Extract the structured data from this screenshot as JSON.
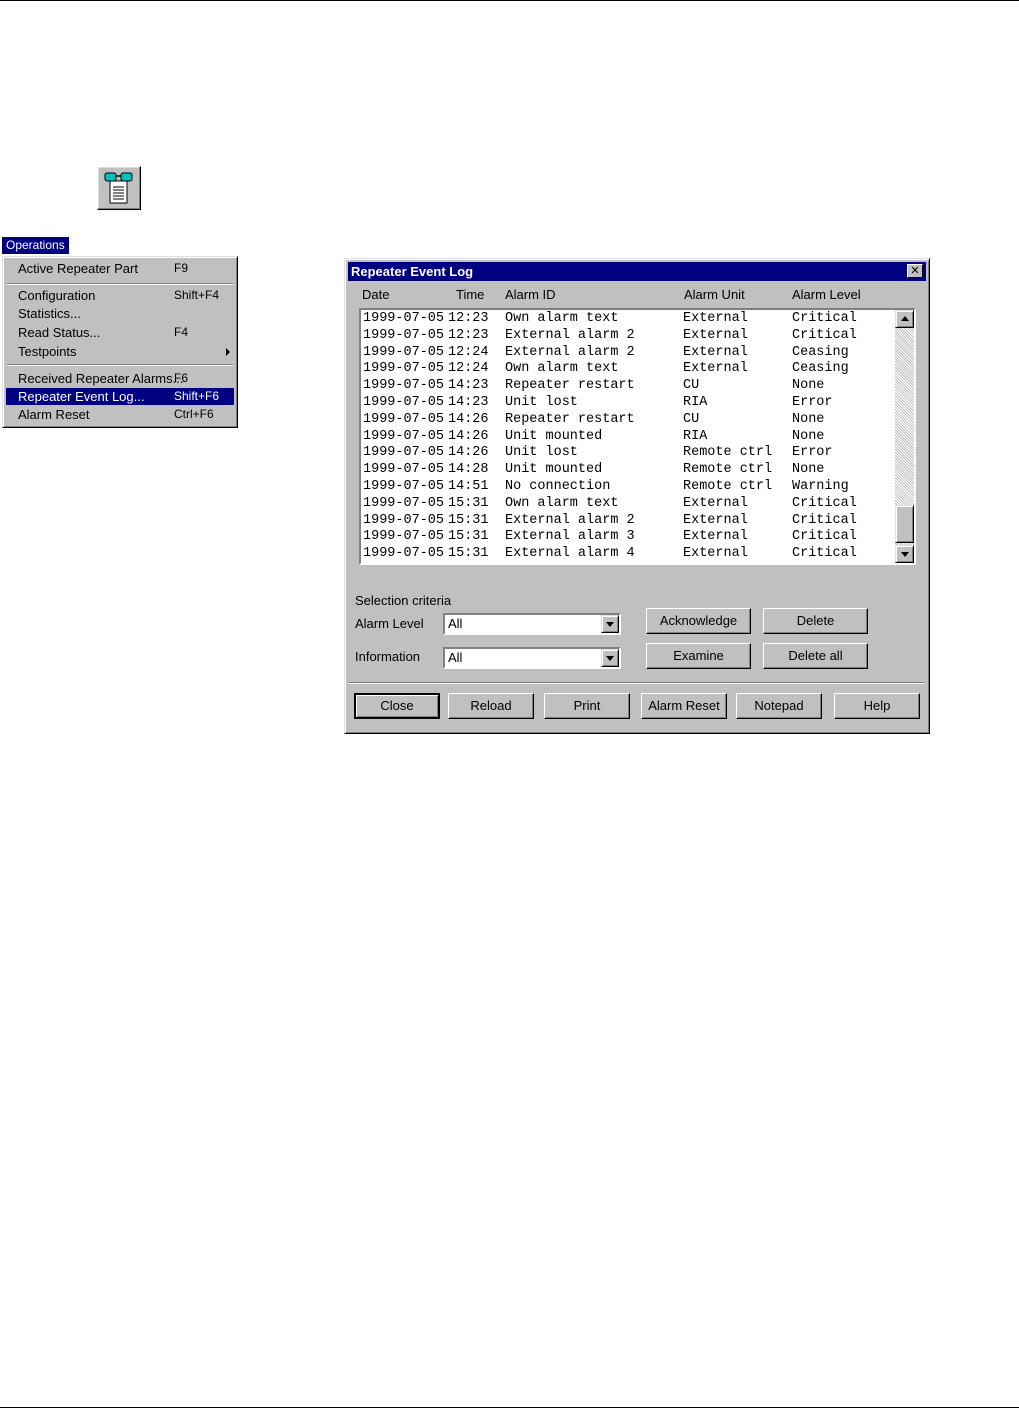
{
  "menu": {
    "title": "Operations",
    "items": [
      {
        "label": "Active Repeater Part",
        "shortcut": "F9"
      },
      {
        "label": "Configuration",
        "shortcut": "Shift+F4"
      },
      {
        "label": "Statistics...",
        "shortcut": ""
      },
      {
        "label": "Read Status...",
        "shortcut": "F4"
      },
      {
        "label": "Testpoints",
        "shortcut": ""
      },
      {
        "label": "Received Repeater Alarms...",
        "shortcut": "F6"
      },
      {
        "label": "Repeater Event Log...",
        "shortcut": "Shift+F6"
      },
      {
        "label": "Alarm Reset",
        "shortcut": "Ctrl+F6"
      }
    ]
  },
  "dialog": {
    "title": "Repeater Event Log",
    "close_glyph": "✕",
    "columns": [
      "Date",
      "Time",
      "Alarm ID",
      "Alarm Unit",
      "Alarm Level"
    ],
    "rows": [
      [
        "1999-07-05",
        "12:23",
        "Own alarm text",
        "External",
        "Critical"
      ],
      [
        "1999-07-05",
        "12:23",
        "External alarm 2",
        "External",
        "Critical"
      ],
      [
        "1999-07-05",
        "12:24",
        "External alarm 2",
        "External",
        "Ceasing"
      ],
      [
        "1999-07-05",
        "12:24",
        "Own alarm text",
        "External",
        "Ceasing"
      ],
      [
        "1999-07-05",
        "14:23",
        "Repeater restart",
        "CU",
        "None"
      ],
      [
        "1999-07-05",
        "14:23",
        "Unit lost",
        "RIA",
        "Error"
      ],
      [
        "1999-07-05",
        "14:26",
        "Repeater restart",
        "CU",
        "None"
      ],
      [
        "1999-07-05",
        "14:26",
        "Unit mounted",
        "RIA",
        "None"
      ],
      [
        "1999-07-05",
        "14:26",
        "Unit lost",
        "Remote ctrl",
        "Error"
      ],
      [
        "1999-07-05",
        "14:28",
        "Unit mounted",
        "Remote ctrl",
        "None"
      ],
      [
        "1999-07-05",
        "14:51",
        "No connection",
        "Remote ctrl",
        "Warning"
      ],
      [
        "1999-07-05",
        "15:31",
        "Own alarm text",
        "External",
        "Critical"
      ],
      [
        "1999-07-05",
        "15:31",
        "External alarm 2",
        "External",
        "Critical"
      ],
      [
        "1999-07-05",
        "15:31",
        "External alarm 3",
        "External",
        "Critical"
      ],
      [
        "1999-07-05",
        "15:31",
        "External alarm 4",
        "External",
        "Critical"
      ]
    ],
    "selection_criteria": "Selection criteria",
    "alarm_level_label": "Alarm Level",
    "alarm_level_value": "All",
    "information_label": "Information",
    "information_value": "All",
    "buttons": {
      "acknowledge": "Acknowledge",
      "delete": "Delete",
      "examine": "Examine",
      "delete_all": "Delete all",
      "close": "Close",
      "reload": "Reload",
      "print": "Print",
      "alarm_reset": "Alarm Reset",
      "notepad": "Notepad",
      "help": "Help"
    }
  }
}
